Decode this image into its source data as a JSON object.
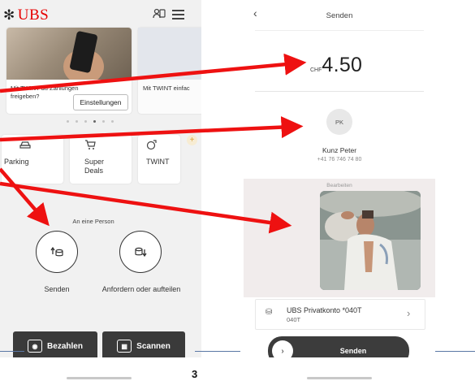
{
  "left": {
    "logo": "UBS",
    "card": {
      "text": "Mit TWINT du Zahlungen freigeben?",
      "button": "Einstellungen",
      "next_text": "Mit TWINT einfac"
    },
    "carousel": {
      "count": 6,
      "active": 3
    },
    "tiles": [
      {
        "label": "Parking",
        "icon": "car-icon"
      },
      {
        "label": "Super Deals",
        "icon": "cart-icon"
      },
      {
        "label": "TWINT",
        "icon": "twint-icon"
      }
    ],
    "section_title": "An eine Person",
    "actions": [
      {
        "label": "Senden",
        "icon": "send-money-icon"
      },
      {
        "label": "Anfordern oder aufteilen",
        "icon": "request-money-icon"
      }
    ],
    "bottom_buttons": [
      {
        "label": "Bezahlen",
        "icon": "pay-icon"
      },
      {
        "label": "Scannen",
        "icon": "qr-scan-icon"
      }
    ]
  },
  "right": {
    "title": "Senden",
    "currency": "CHF",
    "amount": "4.50",
    "recipient": {
      "initials": "PK",
      "name": "Kunz Peter",
      "phone": "+41 76 746 74 80"
    },
    "media_action": "Bearbeiten",
    "account": {
      "name": "UBS Privatkonto *040T",
      "number": "040T"
    },
    "send_button": "Senden"
  },
  "slide": {
    "page_number": "3"
  },
  "colors": {
    "brand": "#e60000",
    "arrow": "#ee1111",
    "dark_button": "#3a3a3a",
    "slide_line": "#5a77a5"
  }
}
